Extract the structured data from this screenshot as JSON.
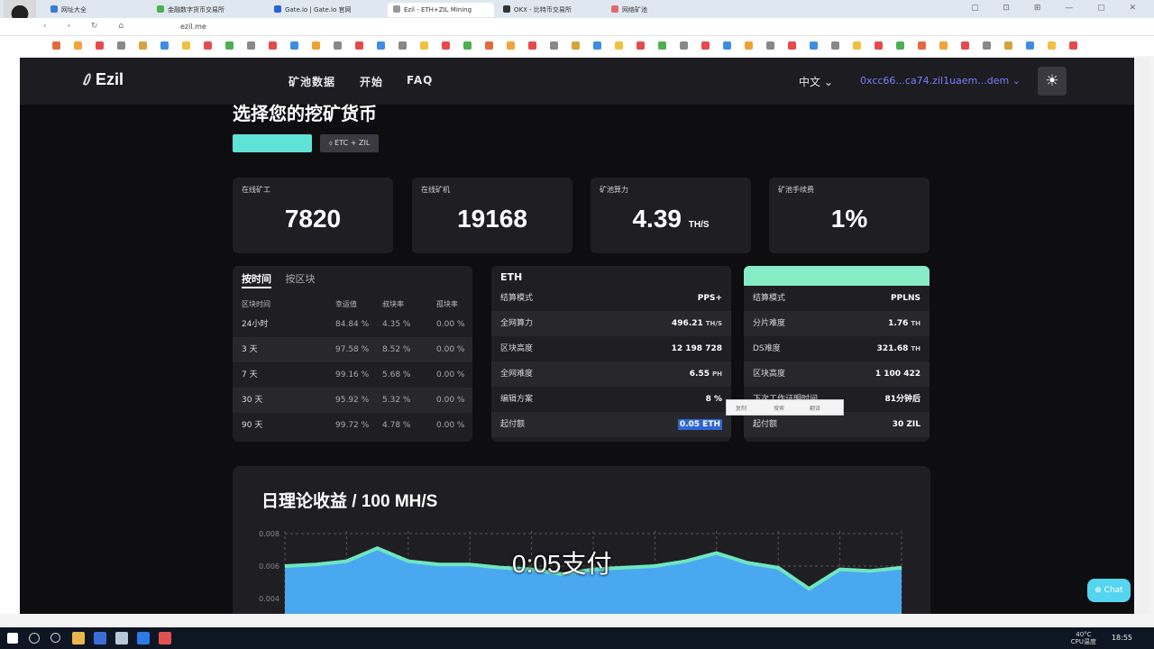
{
  "browser": {
    "tabs": [
      {
        "label": "网址大全",
        "color": "#3a7bd5"
      },
      {
        "label": "金融数字货币交易所",
        "color": "#4caf50"
      },
      {
        "label": "Gate.io | Gate.io 官网",
        "color": "#2a64d8"
      },
      {
        "label": "Ezil - ETH+ZIL Mining",
        "color": "#999999"
      },
      {
        "label": "OKX - 比特币交易所",
        "color": "#333333"
      },
      {
        "label": "网络矿池",
        "color": "#e06b6b"
      }
    ],
    "address": "ezil.me"
  },
  "nav": {
    "logo": "Ezil",
    "links": [
      "矿池数据",
      "开始",
      "FAQ"
    ],
    "language": "中文 ⌄",
    "wallet": "0xcc66...ca74.zil1uaem...dem ⌄",
    "theme_icon": "☀"
  },
  "section": {
    "heading": "选择您的挖矿货币",
    "coin_pill": "ETC + ZIL"
  },
  "stats": [
    {
      "label": "在线矿工",
      "value": "7820",
      "unit": ""
    },
    {
      "label": "在线矿机",
      "value": "19168",
      "unit": ""
    },
    {
      "label": "矿池算力",
      "value": "4.39",
      "unit": "TH/S"
    },
    {
      "label": "矿池手续费",
      "value": "1%",
      "unit": ""
    }
  ],
  "luck_panel": {
    "tab_active": "按时间",
    "tab_other": "按区块",
    "headers": [
      "区块时间",
      "幸运值",
      "叔块率",
      "孤块率"
    ],
    "rows": [
      [
        "24小时",
        "84.84 %",
        "4.35 %",
        "0.00 %"
      ],
      [
        "3 天",
        "97.58 %",
        "8.52 %",
        "0.00 %"
      ],
      [
        "7 天",
        "99.16 %",
        "5.68 %",
        "0.00 %"
      ],
      [
        "30 天",
        "95.92 %",
        "5.32 %",
        "0.00 %"
      ],
      [
        "90 天",
        "99.72 %",
        "4.78 %",
        "0.00 %"
      ]
    ]
  },
  "eth_panel": {
    "title": "ETH",
    "rows": [
      {
        "k": "结算模式",
        "v": "PPS+",
        "u": ""
      },
      {
        "k": "全网算力",
        "v": "496.21",
        "u": "TH/S"
      },
      {
        "k": "区块高度",
        "v": "12 198 728",
        "u": ""
      },
      {
        "k": "全网难度",
        "v": "6.55",
        "u": "PH"
      },
      {
        "k": "编辑方案",
        "v": "8 %",
        "u": ""
      },
      {
        "k": "起付额",
        "v": "0.05 ETH",
        "u": ""
      }
    ]
  },
  "zil_panel": {
    "rows": [
      {
        "k": "结算模式",
        "v": "PPLNS",
        "u": ""
      },
      {
        "k": "分片难度",
        "v": "1.76",
        "u": "TH"
      },
      {
        "k": "DS难度",
        "v": "321.68",
        "u": "TH"
      },
      {
        "k": "区块高度",
        "v": "1 100 422",
        "u": ""
      },
      {
        "k": "下次工作证明时间",
        "v": "81分钟后",
        "u": ""
      },
      {
        "k": "起付额",
        "v": "30 ZIL",
        "u": ""
      }
    ]
  },
  "context_popup": [
    "复制",
    "搜索",
    "翻译"
  ],
  "chart": {
    "title": "日理论收益 / 100 MH/S",
    "tick_labels": [
      "0.008",
      "0.006",
      "0.004"
    ],
    "fill_color": "#4aa8f0",
    "line_color": "#6fe6c0"
  },
  "chart_data": {
    "type": "area",
    "title": "日理论收益 / 100 MH/S",
    "xlabel": "",
    "ylabel": "",
    "ylim": [
      0.002,
      0.008
    ],
    "grid": true,
    "x": [
      0,
      1,
      2,
      3,
      4,
      5,
      6,
      7,
      8,
      9,
      10,
      11,
      12,
      13,
      14,
      15,
      16,
      17,
      18,
      19,
      20
    ],
    "series": [
      {
        "values": [
          0.006,
          0.0061,
          0.0063,
          0.0071,
          0.0063,
          0.0061,
          0.0061,
          0.0059,
          0.0058,
          0.0055,
          0.0058,
          0.0059,
          0.006,
          0.0063,
          0.0068,
          0.0062,
          0.0059,
          0.0046,
          0.0058,
          0.0057,
          0.0059
        ]
      }
    ]
  },
  "subtitle": "0:05支付",
  "chat_button": "⊕ Chat",
  "taskbar": {
    "weather": "40°C",
    "cpu": "CPU温度",
    "time": "18:55"
  }
}
